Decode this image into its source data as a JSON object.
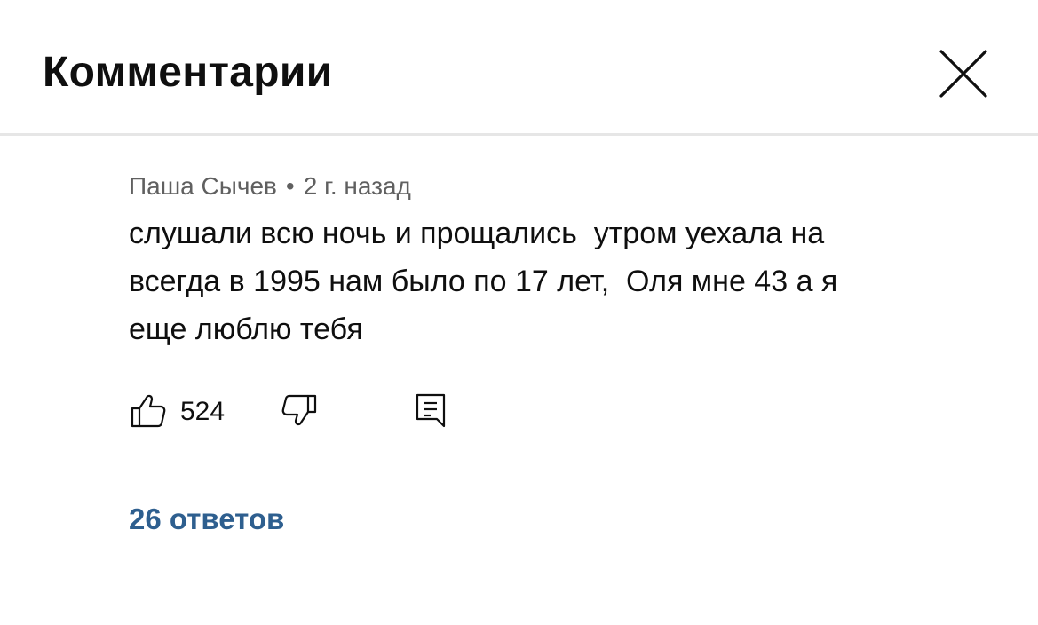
{
  "header": {
    "title": "Комментарии",
    "close_icon": "close-icon"
  },
  "comment": {
    "author": "Паша Сычев",
    "separator": "•",
    "time": "2 г. назад",
    "text": "слушали всю ночь и прощались  утром уехала на\nвсегда в 1995 нам было по 17 лет,  Оля мне 43 а я\nеще люблю тебя",
    "likes": "524",
    "like_icon": "thumbs-up-icon",
    "dislike_icon": "thumbs-down-icon",
    "reply_icon": "reply-icon"
  },
  "replies": {
    "label": "26 ответов"
  },
  "colors": {
    "link": "#2e5f8f",
    "meta_text": "#606060",
    "divider": "#e6e6e6"
  }
}
